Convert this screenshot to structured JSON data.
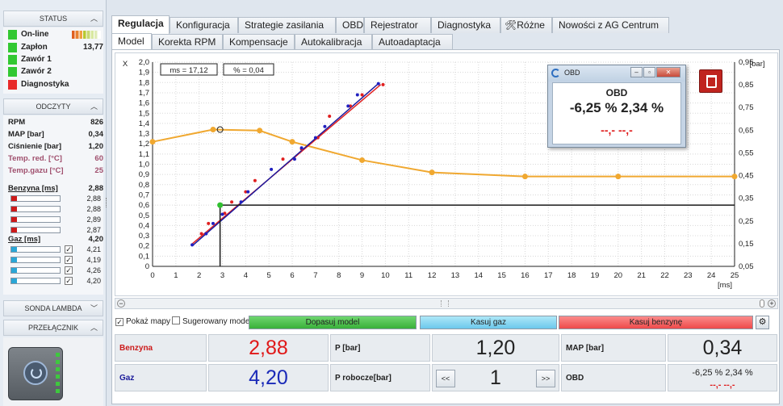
{
  "sidebar": {
    "status": {
      "title": "STATUS",
      "items": [
        {
          "label": "On-line",
          "color": "#32c832"
        },
        {
          "label": "Zapłon",
          "value": "13,77",
          "color": "#32c832"
        },
        {
          "label": "Zawór 1",
          "color": "#32c832"
        },
        {
          "label": "Zawór 2",
          "color": "#32c832"
        },
        {
          "label": "Diagnostyka",
          "color": "#e82a2a"
        }
      ]
    },
    "odczyty": {
      "title": "ODCZYTY",
      "rows": [
        {
          "label": "RPM",
          "value": "826",
          "color": "#222222"
        },
        {
          "label": "MAP [bar]",
          "value": "0,34",
          "color": "#222222"
        },
        {
          "label": "Ciśnienie [bar]",
          "value": "1,20",
          "color": "#222222"
        },
        {
          "label": "Temp. red. [°C]",
          "value": "60",
          "color": "#a0506e"
        },
        {
          "label": "Temp.gazu [°C]",
          "value": "25",
          "color": "#a0506e"
        }
      ],
      "benzyna": {
        "label": "Benzyna [ms]",
        "total": "2,88",
        "injectors": [
          "2,88",
          "2,88",
          "2,89",
          "2,87"
        ],
        "color": "#cc1a1a"
      },
      "gaz": {
        "label": "Gaz [ms]",
        "total": "4,20",
        "injectors": [
          "4,21",
          "4,19",
          "4,26",
          "4,20"
        ],
        "color": "#2aa6d6"
      }
    },
    "sonda": {
      "title": "SONDA LAMBDA"
    },
    "przelacznik": {
      "title": "PRZEŁĄCZNIK"
    }
  },
  "tabs": [
    "Regulacja",
    "Konfiguracja",
    "Strategie zasilania",
    "OBD",
    "Rejestrator",
    "Diagnostyka",
    "Różne",
    "Nowości z AG Centrum"
  ],
  "subtabs": [
    "Model",
    "Korekta RPM",
    "Kompensacje",
    "Autokalibracja",
    "Autoadaptacja"
  ],
  "chart_info": {
    "ms_box": "ms = 17,12",
    "pct_box": "% = 0,04"
  },
  "chart_data": {
    "type": "line",
    "xlabel": "[ms]",
    "ylabel_left": "X",
    "ylabel_right": "[bar]",
    "xlim": [
      0,
      25
    ],
    "ylim_left": [
      0,
      2.0
    ],
    "ylim_right": [
      0.05,
      0.95
    ],
    "x_ticks": [
      0,
      1,
      2,
      3,
      4,
      5,
      6,
      7,
      8,
      9,
      10,
      11,
      12,
      13,
      14,
      15,
      16,
      17,
      18,
      19,
      20,
      21,
      22,
      23,
      24,
      25
    ],
    "y_ticks_left": [
      "0",
      "0,1",
      "0,2",
      "0,3",
      "0,4",
      "0,5",
      "0,6",
      "0,7",
      "0,8",
      "0,9",
      "1,0",
      "1,1",
      "1,2",
      "1,3",
      "1,4",
      "1,5",
      "1,6",
      "1,7",
      "1,8",
      "1,9",
      "2,0"
    ],
    "y_ticks_right": [
      "0,05",
      "0,15",
      "0,25",
      "0,35",
      "0,45",
      "0,55",
      "0,65",
      "0,75",
      "0,85",
      "0,95"
    ],
    "grid": true,
    "series": [
      {
        "color": "#f0a830",
        "points": [
          [
            0,
            1.22
          ],
          [
            2.6,
            1.34
          ],
          [
            4.6,
            1.33
          ],
          [
            6,
            1.22
          ],
          [
            9,
            1.04
          ],
          [
            12,
            0.92
          ],
          [
            16,
            0.88
          ],
          [
            20,
            0.88
          ],
          [
            25,
            0.88
          ]
        ]
      },
      {
        "color": "#e02020",
        "points": [
          [
            1.7,
            0.22
          ],
          [
            9.8,
            1.78
          ]
        ]
      },
      {
        "color": "#1a1aa0",
        "points": [
          [
            1.7,
            0.2
          ],
          [
            9.7,
            1.79
          ]
        ]
      },
      {
        "color": "#1a1a1a",
        "points": [
          [
            2.9,
            0
          ],
          [
            2.9,
            0.6
          ],
          [
            25,
            0.6
          ]
        ]
      }
    ],
    "scatter_red": [
      [
        2.1,
        0.32
      ],
      [
        2.4,
        0.42
      ],
      [
        3.1,
        0.52
      ],
      [
        3.4,
        0.63
      ],
      [
        4.0,
        0.73
      ],
      [
        4.4,
        0.84
      ],
      [
        5.6,
        1.05
      ],
      [
        6.4,
        1.15
      ],
      [
        7.1,
        1.26
      ],
      [
        7.6,
        1.47
      ],
      [
        8.5,
        1.57
      ],
      [
        9.0,
        1.68
      ],
      [
        9.9,
        1.78
      ]
    ],
    "scatter_blue": [
      [
        1.7,
        0.21
      ],
      [
        2.3,
        0.32
      ],
      [
        2.6,
        0.42
      ],
      [
        3.0,
        0.51
      ],
      [
        3.8,
        0.63
      ],
      [
        4.1,
        0.73
      ],
      [
        5.1,
        0.95
      ],
      [
        6.1,
        1.05
      ],
      [
        6.4,
        1.16
      ],
      [
        7.0,
        1.26
      ],
      [
        7.4,
        1.37
      ],
      [
        8.4,
        1.57
      ],
      [
        8.8,
        1.68
      ],
      [
        9.7,
        1.79
      ]
    ],
    "marker_green": [
      2.9,
      0.6
    ],
    "marker_open": [
      2.9,
      1.34
    ]
  },
  "options": {
    "pokaz": {
      "label": "Pokaż mapy",
      "checked": "✓"
    },
    "sugerowany": {
      "label": "Sugerowany model"
    },
    "dopasuj": "Dopasuj model",
    "kasuj_gaz": "Kasuj gaz",
    "kasuj_benzyne": "Kasuj benzynę"
  },
  "bottom": {
    "benzyna_label": "Benzyna",
    "benzyna_value": "2,88",
    "gaz_label": "Gaz",
    "gaz_value": "4,20",
    "p_label": "P [bar]",
    "p_value": "1,20",
    "probocze_label": "P robocze[bar]",
    "probocze_value": "1",
    "prev": "<<",
    "next": ">>",
    "map_label": "MAP [bar]",
    "map_value": "0,34",
    "obd_label": "OBD",
    "obd_value": "-6,25 % 2,34 %",
    "obd_sub": "--,- --,-"
  },
  "obd_window": {
    "title": "OBD",
    "heading": "OBD",
    "value": "-6,25 % 2,34 %",
    "sub": "--,- --,-"
  }
}
